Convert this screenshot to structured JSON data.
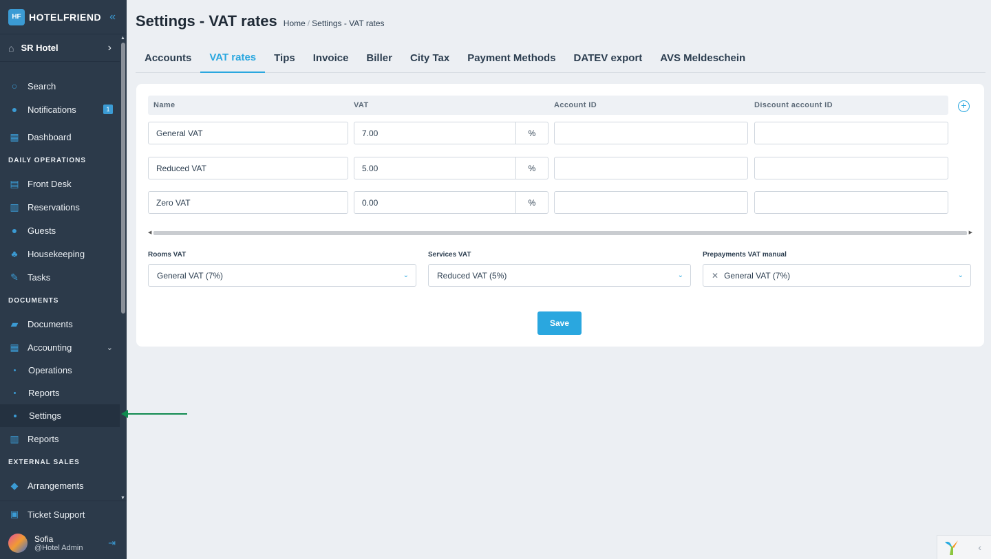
{
  "brand": {
    "name": "HOTELFRIEND",
    "logo_text": "HF"
  },
  "hotel": {
    "name": "SR Hotel"
  },
  "nav": {
    "search": "Search",
    "notifications": "Notifications",
    "notifications_count": "1",
    "dashboard": "Dashboard",
    "section_daily": "DAILY OPERATIONS",
    "front_desk": "Front Desk",
    "reservations": "Reservations",
    "guests": "Guests",
    "housekeeping": "Housekeeping",
    "tasks": "Tasks",
    "section_documents": "DOCUMENTS",
    "documents": "Documents",
    "accounting": "Accounting",
    "accounting_sub": [
      "Operations",
      "Reports",
      "Settings"
    ],
    "reports": "Reports",
    "section_external": "EXTERNAL SALES",
    "arrangements": "Arrangements"
  },
  "bottom": {
    "ticket_support": "Ticket Support",
    "user_name": "Sofia",
    "user_role": "@Hotel Admin"
  },
  "page": {
    "title": "Settings - VAT rates",
    "breadcrumb": [
      "Home",
      "Settings - VAT rates"
    ]
  },
  "tabs": [
    "Accounts",
    "VAT rates",
    "Tips",
    "Invoice",
    "Biller",
    "City Tax",
    "Payment Methods",
    "DATEV export",
    "AVS Meldeschein"
  ],
  "active_tab": "VAT rates",
  "table": {
    "headers": [
      "Name",
      "VAT",
      "Account ID",
      "Discount account ID"
    ],
    "unit": "%",
    "rows": [
      {
        "name": "General VAT",
        "vat": "7.00",
        "account_id": "",
        "discount_account_id": ""
      },
      {
        "name": "Reduced VAT",
        "vat": "5.00",
        "account_id": "",
        "discount_account_id": ""
      },
      {
        "name": "Zero VAT",
        "vat": "0.00",
        "account_id": "",
        "discount_account_id": ""
      }
    ]
  },
  "selects": {
    "rooms_label": "Rooms VAT",
    "rooms_value": "General VAT (7%)",
    "services_label": "Services VAT",
    "services_value": "Reduced VAT (5%)",
    "prepayments_label": "Prepayments VAT manual",
    "prepayments_value": "General VAT (7%)"
  },
  "save_label": "Save",
  "colors": {
    "accent": "#2aa7df",
    "sidebar": "#2c3a4a",
    "annotation_arrow": "#0f8a4f"
  }
}
